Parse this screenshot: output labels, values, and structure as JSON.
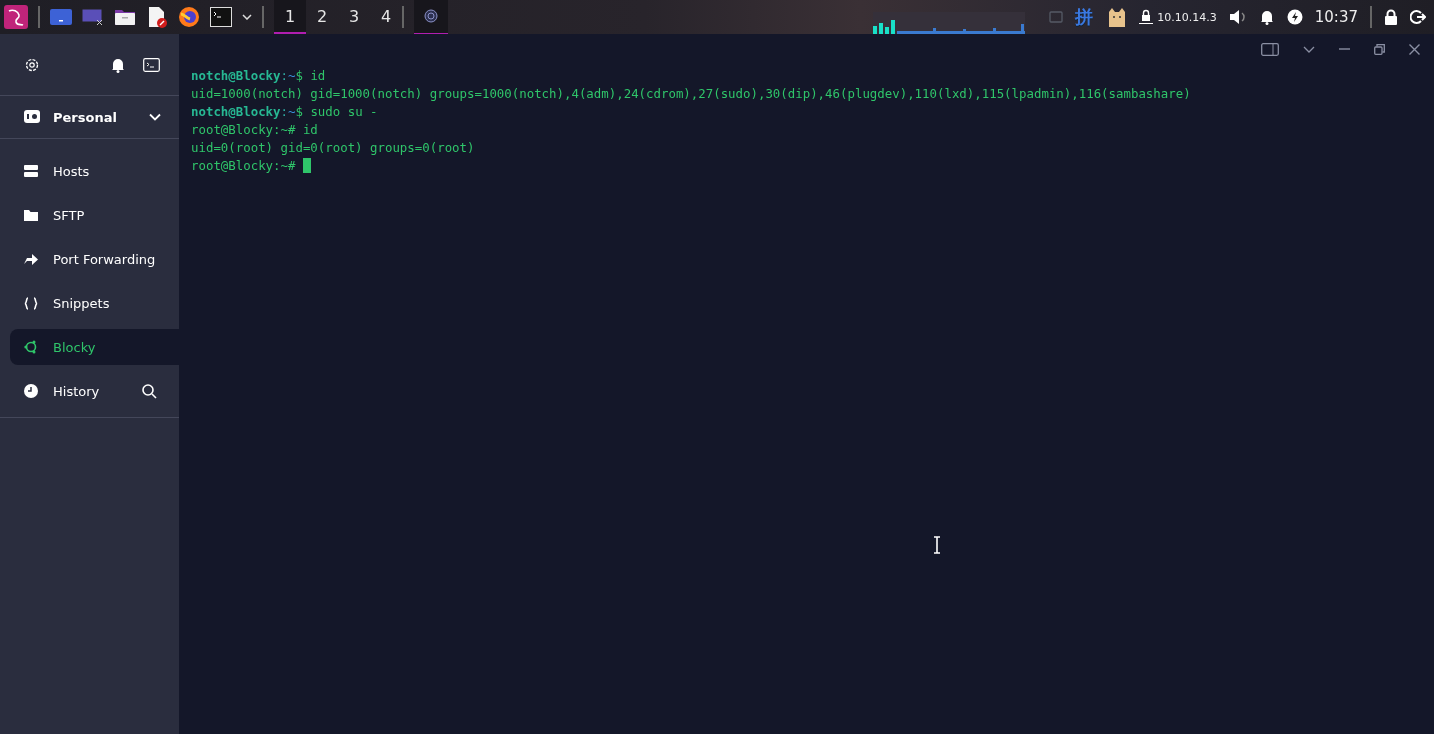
{
  "taskbar": {
    "workspaces": [
      {
        "label": "1",
        "selected": true
      },
      {
        "label": "2",
        "selected": false
      },
      {
        "label": "3",
        "selected": false
      },
      {
        "label": "4",
        "selected": false
      }
    ],
    "input_method": "拼",
    "ip": "10.10.14.3",
    "clock": "10:37"
  },
  "sidebar": {
    "vault": {
      "label": "Personal",
      "expanded": false
    },
    "items": [
      {
        "label": "Hosts",
        "kind": "hosts",
        "selected": false
      },
      {
        "label": "SFTP",
        "kind": "sftp",
        "selected": false
      },
      {
        "label": "Port Forwarding",
        "kind": "forwarding",
        "selected": false
      },
      {
        "label": "Snippets",
        "kind": "snippets",
        "selected": false
      },
      {
        "label": "Blocky",
        "kind": "host",
        "selected": true
      },
      {
        "label": "History",
        "kind": "history",
        "selected": false
      }
    ]
  },
  "terminal": {
    "lines": [
      {
        "segments": [
          {
            "kind": "user",
            "text": "notch@Blocky"
          },
          {
            "kind": "sep",
            "text": ":"
          },
          {
            "kind": "path",
            "text": "~"
          },
          {
            "kind": "plain",
            "text": "$ id"
          }
        ],
        "cursor": false
      },
      {
        "segments": [
          {
            "kind": "plain",
            "text": "uid=1000(notch) gid=1000(notch) groups=1000(notch),4(adm),24(cdrom),27(sudo),30(dip),46(plugdev),110(lxd),115(lpadmin),116(sambashare)"
          }
        ],
        "cursor": false
      },
      {
        "segments": [
          {
            "kind": "user",
            "text": "notch@Blocky"
          },
          {
            "kind": "sep",
            "text": ":"
          },
          {
            "kind": "path",
            "text": "~"
          },
          {
            "kind": "plain",
            "text": "$ sudo su -"
          }
        ],
        "cursor": false
      },
      {
        "segments": [
          {
            "kind": "plain",
            "text": "root@Blocky:~# id"
          }
        ],
        "cursor": false
      },
      {
        "segments": [
          {
            "kind": "plain",
            "text": "uid=0(root) gid=0(root) groups=0(root)"
          }
        ],
        "cursor": false
      },
      {
        "segments": [
          {
            "kind": "plain",
            "text": "root@Blocky:~# "
          }
        ],
        "cursor": true
      }
    ]
  }
}
